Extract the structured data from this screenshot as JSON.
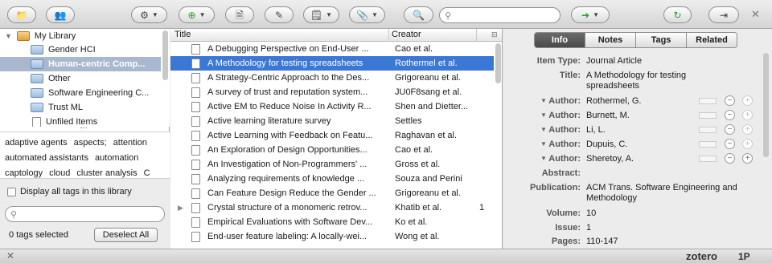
{
  "toolbar": {
    "search_placeholder": "",
    "icons": [
      "new-collection",
      "new-group",
      "actions-gear",
      "new-item",
      "new-note",
      "add-by-identifier",
      "new-note-dropdown",
      "attach",
      "advanced-search",
      "go-to-url",
      "sync",
      "fullscreen"
    ]
  },
  "collections": [
    {
      "label": "My Library",
      "type": "library"
    },
    {
      "label": "Gender HCI",
      "type": "folder"
    },
    {
      "label": "Human-centric Comp...",
      "type": "folder",
      "selected": true
    },
    {
      "label": "Other",
      "type": "folder"
    },
    {
      "label": "Software Engineering C...",
      "type": "folder"
    },
    {
      "label": "Trust ML",
      "type": "folder"
    },
    {
      "label": "Unfiled Items",
      "type": "file"
    }
  ],
  "tags": {
    "line1": [
      "adaptive agents",
      "aspects;",
      "attention"
    ],
    "line2": [
      "automated assistants",
      "automation"
    ],
    "line3": [
      "captology",
      "cloud",
      "cluster analysis",
      "C"
    ],
    "display_all_label": "Display all tags in this library",
    "selected_count": "0 tags selected",
    "deselect_label": "Deselect All"
  },
  "items": {
    "header_title": "Title",
    "header_creator": "Creator",
    "rows": [
      {
        "title": "A Debugging Perspective on End-User ...",
        "creator": "Cao et al.",
        "count": ""
      },
      {
        "title": "A Methodology for testing spreadsheets",
        "creator": "Rothermel et al.",
        "count": "",
        "selected": true
      },
      {
        "title": "A Strategy-Centric Approach to the Des...",
        "creator": "Grigoreanu et al.",
        "count": ""
      },
      {
        "title": "A survey of trust and reputation system...",
        "creator": "JU0F8sang et al.",
        "count": ""
      },
      {
        "title": "Active EM to Reduce Noise In Activity R...",
        "creator": "Shen and Dietter...",
        "count": ""
      },
      {
        "title": "Active learning literature survey",
        "creator": "Settles",
        "count": ""
      },
      {
        "title": "Active Learning with Feedback on Featu...",
        "creator": "Raghavan et al.",
        "count": ""
      },
      {
        "title": "An Exploration of Design Opportunities...",
        "creator": "Cao et al.",
        "count": ""
      },
      {
        "title": "An Investigation of Non-Programmers' ...",
        "creator": "Gross et al.",
        "count": ""
      },
      {
        "title": "Analyzing requirements of knowledge ...",
        "creator": "Souza and Perini",
        "count": ""
      },
      {
        "title": "Can Feature Design Reduce the Gender ...",
        "creator": "Grigoreanu et al.",
        "count": ""
      },
      {
        "title": "Crystal structure of a monomeric retrov...",
        "creator": "Khatib et al.",
        "count": "1"
      },
      {
        "title": "Empirical Evaluations with Software Dev...",
        "creator": "Ko et al.",
        "count": ""
      },
      {
        "title": "End-user feature labeling: A locally-wei...",
        "creator": "Wong et al.",
        "count": ""
      }
    ]
  },
  "tabs": [
    "Info",
    "Notes",
    "Tags",
    "Related"
  ],
  "info": {
    "item_type_label": "Item Type:",
    "item_type": "Journal Article",
    "title_label": "Title:",
    "title_1": "A Methodology for testing",
    "title_2": "spreadsheets",
    "author_label": "Author:",
    "authors": [
      "Rothermel, G.",
      "Burnett, M.",
      "Li, L.",
      "Dupuis, C.",
      "Sheretoy, A."
    ],
    "abstract_label": "Abstract:",
    "publication_label": "Publication:",
    "publication_1": "ACM Trans. Software Engineering and",
    "publication_2": "Methodology",
    "volume_label": "Volume:",
    "volume": "10",
    "issue_label": "Issue:",
    "issue": "1",
    "pages_label": "Pages:",
    "pages": "110-147"
  },
  "status": {
    "brand": "zotero",
    "badge": "1P"
  },
  "colors": {
    "selection_row": "#3b78d6",
    "selection_collection": "#a9b8cf",
    "active_tab": "#555555"
  }
}
